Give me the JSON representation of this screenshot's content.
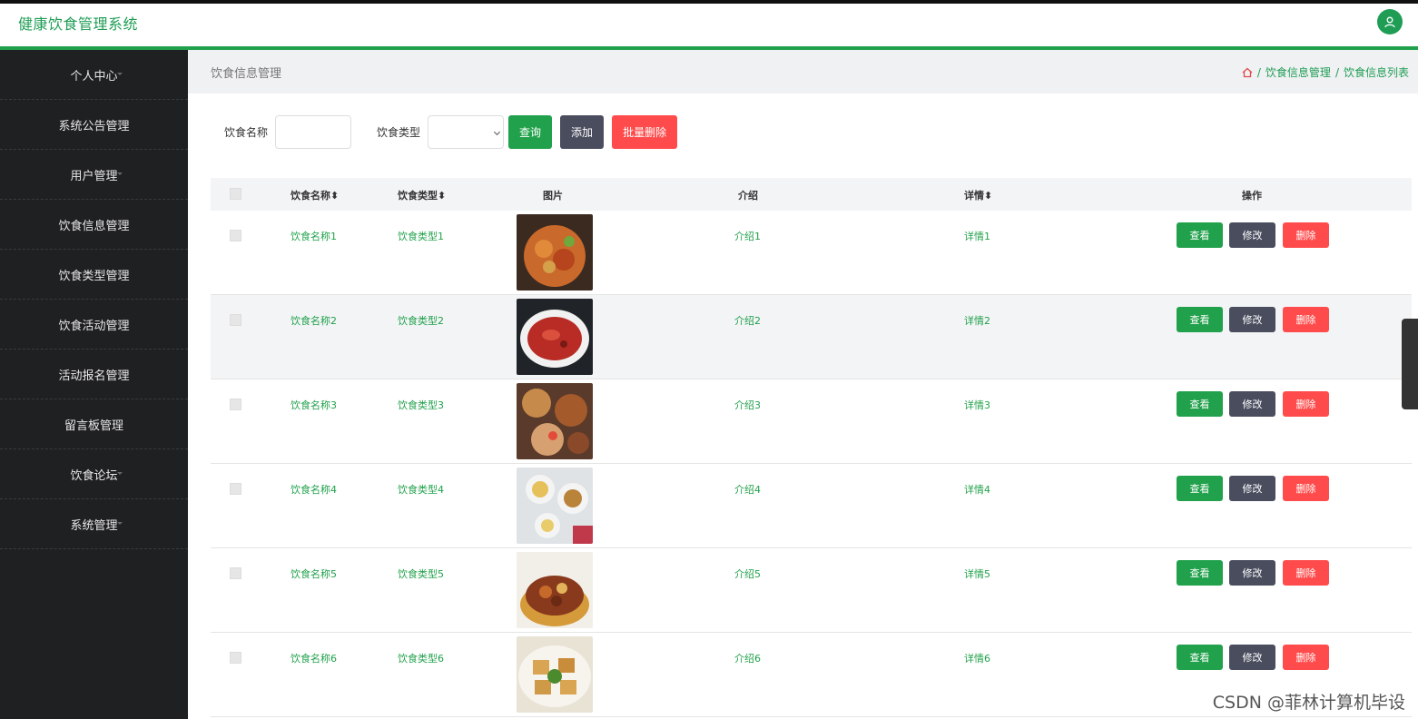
{
  "header": {
    "app_title": "健康饮食管理系统"
  },
  "sidebar": {
    "items": [
      {
        "label": "个人中心"
      },
      {
        "label": "系统公告管理"
      },
      {
        "label": "用户管理"
      },
      {
        "label": "饮食信息管理"
      },
      {
        "label": "饮食类型管理"
      },
      {
        "label": "饮食活动管理"
      },
      {
        "label": "活动报名管理"
      },
      {
        "label": "留言板管理"
      },
      {
        "label": "饮食论坛"
      },
      {
        "label": "系统管理"
      }
    ]
  },
  "page": {
    "title": "饮食信息管理",
    "breadcrumb": [
      "饮食信息管理",
      "饮食信息列表"
    ]
  },
  "search": {
    "name_label": "饮食名称",
    "name_value": "",
    "type_label": "饮食类型",
    "type_value": "",
    "query_button": "查询",
    "add_button": "添加",
    "batch_delete_button": "批量删除"
  },
  "table": {
    "headers": {
      "name": "饮食名称",
      "type": "饮食类型",
      "image": "图片",
      "intro": "介绍",
      "detail": "详情",
      "actions": "操作"
    },
    "sort_glyph": "⬍",
    "action_labels": {
      "view": "查看",
      "edit": "修改",
      "delete": "删除"
    },
    "rows": [
      {
        "name": "饮食名称1",
        "type": "饮食类型1",
        "intro": "介绍1",
        "detail": "详情1"
      },
      {
        "name": "饮食名称2",
        "type": "饮食类型2",
        "intro": "介绍2",
        "detail": "详情2"
      },
      {
        "name": "饮食名称3",
        "type": "饮食类型3",
        "intro": "介绍3",
        "detail": "详情3"
      },
      {
        "name": "饮食名称4",
        "type": "饮食类型4",
        "intro": "介绍4",
        "detail": "详情4"
      },
      {
        "name": "饮食名称5",
        "type": "饮食类型5",
        "intro": "介绍5",
        "detail": "详情5"
      },
      {
        "name": "饮食名称6",
        "type": "饮食类型6",
        "intro": "介绍6",
        "detail": "详情6"
      }
    ]
  },
  "watermark": "CSDN @菲林计算机毕设",
  "colors": {
    "accent": "#21a14b",
    "dark_button": "#4a4d5e",
    "danger": "#ff4b4b",
    "sidebar_bg": "#1f2022"
  },
  "icons": {
    "avatar": "user-icon",
    "home": "home-icon"
  }
}
